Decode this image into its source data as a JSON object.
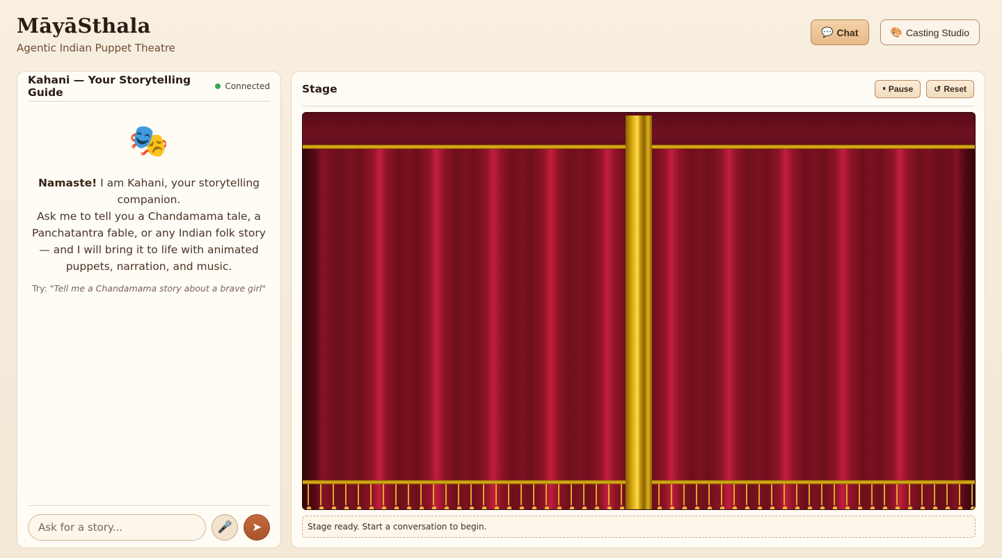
{
  "app": {
    "title": "MāyāSthala",
    "subtitle": "Agentic Indian Puppet Theatre"
  },
  "nav": {
    "chat_label": "Chat",
    "chat_icon": "💬",
    "casting_label": "Casting Studio",
    "casting_icon": "🎨"
  },
  "chat": {
    "title": "Kahani — Your Storytelling Guide",
    "status": "Connected",
    "status_color": "#3aa856",
    "welcome_icon": "🎭",
    "greeting_bold": "Namaste!",
    "greeting_rest": " I am Kahani, your storytelling companion.",
    "message": "Ask me to tell you a Chandamama tale, a Panchatantra fable, or any Indian folk story — and I will bring it to life with animated puppets, narration, and music.",
    "try_label": "Try: ",
    "try_example": "\"Tell me a Chandamama story about a brave girl\"",
    "input_placeholder": "Ask for a story...",
    "mic_icon": "🎤",
    "send_icon": "➤"
  },
  "stage": {
    "title": "Stage",
    "pause_label": "Pause",
    "pause_icon": "⏸",
    "reset_label": "Reset",
    "reset_icon": "↺",
    "status": "Stage ready. Start a conversation to begin."
  },
  "colors": {
    "accent": "#c46a3c",
    "curtain": "#8c1424",
    "gold": "#f0c020"
  }
}
